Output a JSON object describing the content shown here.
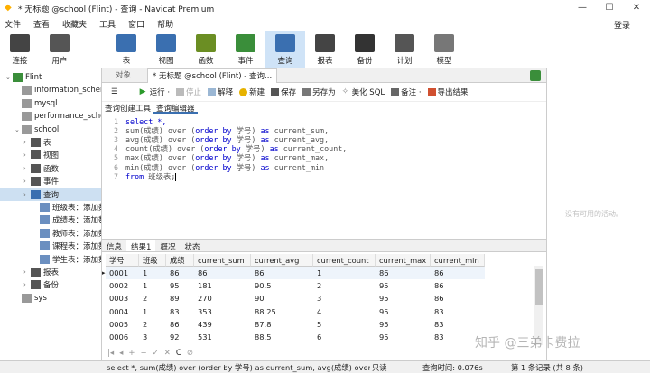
{
  "title": "* 无标题 @school (Flint) - 查询 - Navicat Premium",
  "menu": [
    "文件",
    "查看",
    "收藏夹",
    "工具",
    "窗口",
    "帮助"
  ],
  "login": "登录",
  "toolbar": [
    {
      "label": "连接",
      "icon": "plug-icon"
    },
    {
      "label": "用户",
      "icon": "user-icon"
    },
    {
      "label": "表",
      "icon": "table-icon"
    },
    {
      "label": "视图",
      "icon": "view-icon"
    },
    {
      "label": "函数",
      "icon": "function-icon"
    },
    {
      "label": "事件",
      "icon": "event-icon"
    },
    {
      "label": "查询",
      "icon": "query-icon"
    },
    {
      "label": "报表",
      "icon": "report-icon"
    },
    {
      "label": "备份",
      "icon": "backup-icon"
    },
    {
      "label": "计划",
      "icon": "schedule-icon"
    },
    {
      "label": "模型",
      "icon": "model-icon"
    }
  ],
  "tree": [
    {
      "label": "Flint",
      "indent": 0,
      "icon": "connection-icon",
      "expanded": true
    },
    {
      "label": "information_schema",
      "indent": 1,
      "icon": "database-icon"
    },
    {
      "label": "mysql",
      "indent": 1,
      "icon": "database-icon"
    },
    {
      "label": "performance_schema",
      "indent": 1,
      "icon": "database-icon"
    },
    {
      "label": "school",
      "indent": 1,
      "icon": "database-icon",
      "expanded": true
    },
    {
      "label": "表",
      "indent": 2,
      "icon": "table-icon"
    },
    {
      "label": "视图",
      "indent": 2,
      "icon": "view-icon"
    },
    {
      "label": "函数",
      "indent": 2,
      "icon": "function-icon"
    },
    {
      "label": "事件",
      "indent": 2,
      "icon": "event-icon"
    },
    {
      "label": "查询",
      "indent": 2,
      "icon": "query-icon",
      "selected": true
    },
    {
      "label": "班级表：添加数据",
      "indent": 3,
      "icon": "query-item-icon"
    },
    {
      "label": "成绩表：添加数据",
      "indent": 3,
      "icon": "query-item-icon"
    },
    {
      "label": "教师表：添加数据",
      "indent": 3,
      "icon": "query-item-icon"
    },
    {
      "label": "课程表：添加数据",
      "indent": 3,
      "icon": "query-item-icon"
    },
    {
      "label": "学生表：添加数据",
      "indent": 3,
      "icon": "query-item-icon"
    },
    {
      "label": "报表",
      "indent": 2,
      "icon": "report-icon"
    },
    {
      "label": "备份",
      "indent": 2,
      "icon": "backup-icon"
    },
    {
      "label": "sys",
      "indent": 1,
      "icon": "database-icon"
    }
  ],
  "tabs": [
    {
      "label": "对象"
    },
    {
      "label": "* 无标题 @school (Flint) - 查询..."
    }
  ],
  "query_toolbar": {
    "run": "运行 ·",
    "stop": "停止",
    "explain": "解释",
    "new": "新建",
    "save": "保存",
    "save_as": "另存为",
    "beautify": "美化 SQL",
    "comment": "备注 ·",
    "export": "导出结果"
  },
  "subtabs": [
    "查询创建工具",
    "查询编辑器"
  ],
  "sql_lines": [
    [
      {
        "t": "select *,",
        "c": "kw"
      }
    ],
    [
      {
        "t": "sum(",
        "c": "fn"
      },
      {
        "t": "成绩",
        "c": "ch"
      },
      {
        "t": ") over (",
        "c": "fn"
      },
      {
        "t": "order by",
        "c": "kw"
      },
      {
        "t": " 学号) ",
        "c": "fn"
      },
      {
        "t": "as",
        "c": "kw"
      },
      {
        "t": " current_sum,",
        "c": "fn"
      }
    ],
    [
      {
        "t": "avg(",
        "c": "fn"
      },
      {
        "t": "成绩",
        "c": "ch"
      },
      {
        "t": ") over (",
        "c": "fn"
      },
      {
        "t": "order by",
        "c": "kw"
      },
      {
        "t": " 学号) ",
        "c": "fn"
      },
      {
        "t": "as",
        "c": "kw"
      },
      {
        "t": " current_avg,",
        "c": "fn"
      }
    ],
    [
      {
        "t": "count(",
        "c": "fn"
      },
      {
        "t": "成绩",
        "c": "ch"
      },
      {
        "t": ") over (",
        "c": "fn"
      },
      {
        "t": "order by",
        "c": "kw"
      },
      {
        "t": " 学号) ",
        "c": "fn"
      },
      {
        "t": "as",
        "c": "kw"
      },
      {
        "t": " current_count,",
        "c": "fn"
      }
    ],
    [
      {
        "t": "max(",
        "c": "fn"
      },
      {
        "t": "成绩",
        "c": "ch"
      },
      {
        "t": ") over (",
        "c": "fn"
      },
      {
        "t": "order by",
        "c": "kw"
      },
      {
        "t": " 学号) ",
        "c": "fn"
      },
      {
        "t": "as",
        "c": "kw"
      },
      {
        "t": " current_max,",
        "c": "fn"
      }
    ],
    [
      {
        "t": "min(",
        "c": "fn"
      },
      {
        "t": "成绩",
        "c": "ch"
      },
      {
        "t": ") over (",
        "c": "fn"
      },
      {
        "t": "order by",
        "c": "kw"
      },
      {
        "t": " 学号) ",
        "c": "fn"
      },
      {
        "t": "as",
        "c": "kw"
      },
      {
        "t": " current_min",
        "c": "fn"
      }
    ],
    [
      {
        "t": "from",
        "c": "kw"
      },
      {
        "t": " 班级表;",
        "c": "fn"
      }
    ]
  ],
  "result_tabs": [
    "信息",
    "结果1",
    "概况",
    "状态"
  ],
  "grid": {
    "columns": [
      "学号",
      "班级",
      "成绩",
      "current_sum",
      "current_avg",
      "current_count",
      "current_max",
      "current_min"
    ],
    "rows": [
      [
        "0001",
        "1",
        "86",
        "86",
        "86",
        "1",
        "86",
        "86"
      ],
      [
        "0002",
        "1",
        "95",
        "181",
        "90.5",
        "2",
        "95",
        "86"
      ],
      [
        "0003",
        "2",
        "89",
        "270",
        "90",
        "3",
        "95",
        "86"
      ],
      [
        "0004",
        "1",
        "83",
        "353",
        "88.25",
        "4",
        "95",
        "83"
      ],
      [
        "0005",
        "2",
        "86",
        "439",
        "87.8",
        "5",
        "95",
        "83"
      ],
      [
        "0006",
        "3",
        "92",
        "531",
        "88.5",
        "6",
        "95",
        "83"
      ]
    ]
  },
  "navbar": [
    "|◂",
    "◂",
    "+",
    "−",
    "✓",
    "✕",
    "C",
    "⊘"
  ],
  "status": {
    "sql": "select *, sum(成绩) over (order by 学号) as current_sum, avg(成绩) over (order by",
    "mode": "只读",
    "time": "查询时间: 0.076s",
    "records": "第 1 条记录 (共 8 条)"
  },
  "activate": "没有可用的活动。",
  "watermark": "知乎 @三弟卡费拉",
  "colors": {
    "selected": "#cde0f2",
    "keyword": "#0000cc",
    "toolbar_active": "#cfe3f7"
  }
}
